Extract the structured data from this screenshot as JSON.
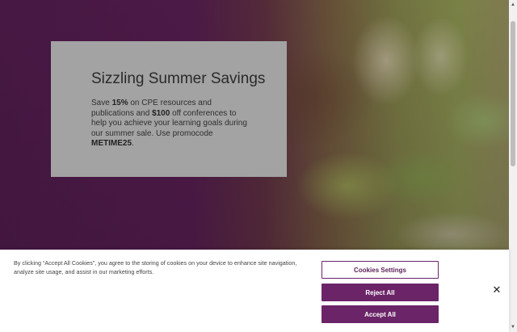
{
  "promo": {
    "title": "Sizzling Summer Savings",
    "body_parts": [
      {
        "text": "Save ",
        "bold": false
      },
      {
        "text": "15%",
        "bold": true
      },
      {
        "text": " on CPE resources and publications and ",
        "bold": false
      },
      {
        "text": "$100",
        "bold": true
      },
      {
        "text": " off conferences to help you achieve your learning goals during our summer sale. Use promocode ",
        "bold": false
      },
      {
        "text": "METIME25",
        "bold": true
      },
      {
        "text": ".",
        "bold": false
      }
    ]
  },
  "cookie_banner": {
    "text": "By clicking “Accept All Cookies”, you agree to the storing of cookies on your device to enhance site navigation, analyze site usage, and assist in our marketing efforts.",
    "settings_label": "Cookies Settings",
    "reject_label": "Reject All",
    "accept_label": "Accept All",
    "close_icon": "close-icon",
    "close_glyph": "✕"
  },
  "scrollbar": {
    "up_glyph": "▲",
    "down_glyph": "▼"
  },
  "colors": {
    "brand_purple": "#6b2468",
    "hero_purple": "#4c1a48",
    "card_gray": "#a3a3a3"
  }
}
